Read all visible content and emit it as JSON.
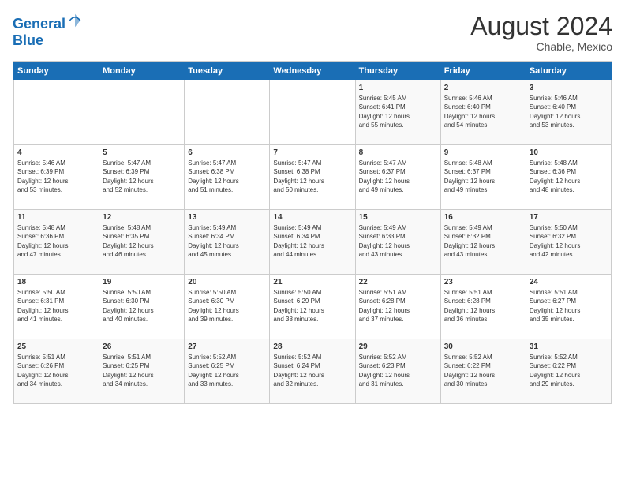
{
  "header": {
    "logo_line1": "General",
    "logo_line2": "Blue",
    "title": "August 2024",
    "subtitle": "Chable, Mexico"
  },
  "weekdays": [
    "Sunday",
    "Monday",
    "Tuesday",
    "Wednesday",
    "Thursday",
    "Friday",
    "Saturday"
  ],
  "weeks": [
    [
      {
        "day": "",
        "info": ""
      },
      {
        "day": "",
        "info": ""
      },
      {
        "day": "",
        "info": ""
      },
      {
        "day": "",
        "info": ""
      },
      {
        "day": "1",
        "info": "Sunrise: 5:45 AM\nSunset: 6:41 PM\nDaylight: 12 hours\nand 55 minutes."
      },
      {
        "day": "2",
        "info": "Sunrise: 5:46 AM\nSunset: 6:40 PM\nDaylight: 12 hours\nand 54 minutes."
      },
      {
        "day": "3",
        "info": "Sunrise: 5:46 AM\nSunset: 6:40 PM\nDaylight: 12 hours\nand 53 minutes."
      }
    ],
    [
      {
        "day": "4",
        "info": "Sunrise: 5:46 AM\nSunset: 6:39 PM\nDaylight: 12 hours\nand 53 minutes."
      },
      {
        "day": "5",
        "info": "Sunrise: 5:47 AM\nSunset: 6:39 PM\nDaylight: 12 hours\nand 52 minutes."
      },
      {
        "day": "6",
        "info": "Sunrise: 5:47 AM\nSunset: 6:38 PM\nDaylight: 12 hours\nand 51 minutes."
      },
      {
        "day": "7",
        "info": "Sunrise: 5:47 AM\nSunset: 6:38 PM\nDaylight: 12 hours\nand 50 minutes."
      },
      {
        "day": "8",
        "info": "Sunrise: 5:47 AM\nSunset: 6:37 PM\nDaylight: 12 hours\nand 49 minutes."
      },
      {
        "day": "9",
        "info": "Sunrise: 5:48 AM\nSunset: 6:37 PM\nDaylight: 12 hours\nand 49 minutes."
      },
      {
        "day": "10",
        "info": "Sunrise: 5:48 AM\nSunset: 6:36 PM\nDaylight: 12 hours\nand 48 minutes."
      }
    ],
    [
      {
        "day": "11",
        "info": "Sunrise: 5:48 AM\nSunset: 6:36 PM\nDaylight: 12 hours\nand 47 minutes."
      },
      {
        "day": "12",
        "info": "Sunrise: 5:48 AM\nSunset: 6:35 PM\nDaylight: 12 hours\nand 46 minutes."
      },
      {
        "day": "13",
        "info": "Sunrise: 5:49 AM\nSunset: 6:34 PM\nDaylight: 12 hours\nand 45 minutes."
      },
      {
        "day": "14",
        "info": "Sunrise: 5:49 AM\nSunset: 6:34 PM\nDaylight: 12 hours\nand 44 minutes."
      },
      {
        "day": "15",
        "info": "Sunrise: 5:49 AM\nSunset: 6:33 PM\nDaylight: 12 hours\nand 43 minutes."
      },
      {
        "day": "16",
        "info": "Sunrise: 5:49 AM\nSunset: 6:32 PM\nDaylight: 12 hours\nand 43 minutes."
      },
      {
        "day": "17",
        "info": "Sunrise: 5:50 AM\nSunset: 6:32 PM\nDaylight: 12 hours\nand 42 minutes."
      }
    ],
    [
      {
        "day": "18",
        "info": "Sunrise: 5:50 AM\nSunset: 6:31 PM\nDaylight: 12 hours\nand 41 minutes."
      },
      {
        "day": "19",
        "info": "Sunrise: 5:50 AM\nSunset: 6:30 PM\nDaylight: 12 hours\nand 40 minutes."
      },
      {
        "day": "20",
        "info": "Sunrise: 5:50 AM\nSunset: 6:30 PM\nDaylight: 12 hours\nand 39 minutes."
      },
      {
        "day": "21",
        "info": "Sunrise: 5:50 AM\nSunset: 6:29 PM\nDaylight: 12 hours\nand 38 minutes."
      },
      {
        "day": "22",
        "info": "Sunrise: 5:51 AM\nSunset: 6:28 PM\nDaylight: 12 hours\nand 37 minutes."
      },
      {
        "day": "23",
        "info": "Sunrise: 5:51 AM\nSunset: 6:28 PM\nDaylight: 12 hours\nand 36 minutes."
      },
      {
        "day": "24",
        "info": "Sunrise: 5:51 AM\nSunset: 6:27 PM\nDaylight: 12 hours\nand 35 minutes."
      }
    ],
    [
      {
        "day": "25",
        "info": "Sunrise: 5:51 AM\nSunset: 6:26 PM\nDaylight: 12 hours\nand 34 minutes."
      },
      {
        "day": "26",
        "info": "Sunrise: 5:51 AM\nSunset: 6:25 PM\nDaylight: 12 hours\nand 34 minutes."
      },
      {
        "day": "27",
        "info": "Sunrise: 5:52 AM\nSunset: 6:25 PM\nDaylight: 12 hours\nand 33 minutes."
      },
      {
        "day": "28",
        "info": "Sunrise: 5:52 AM\nSunset: 6:24 PM\nDaylight: 12 hours\nand 32 minutes."
      },
      {
        "day": "29",
        "info": "Sunrise: 5:52 AM\nSunset: 6:23 PM\nDaylight: 12 hours\nand 31 minutes."
      },
      {
        "day": "30",
        "info": "Sunrise: 5:52 AM\nSunset: 6:22 PM\nDaylight: 12 hours\nand 30 minutes."
      },
      {
        "day": "31",
        "info": "Sunrise: 5:52 AM\nSunset: 6:22 PM\nDaylight: 12 hours\nand 29 minutes."
      }
    ]
  ]
}
